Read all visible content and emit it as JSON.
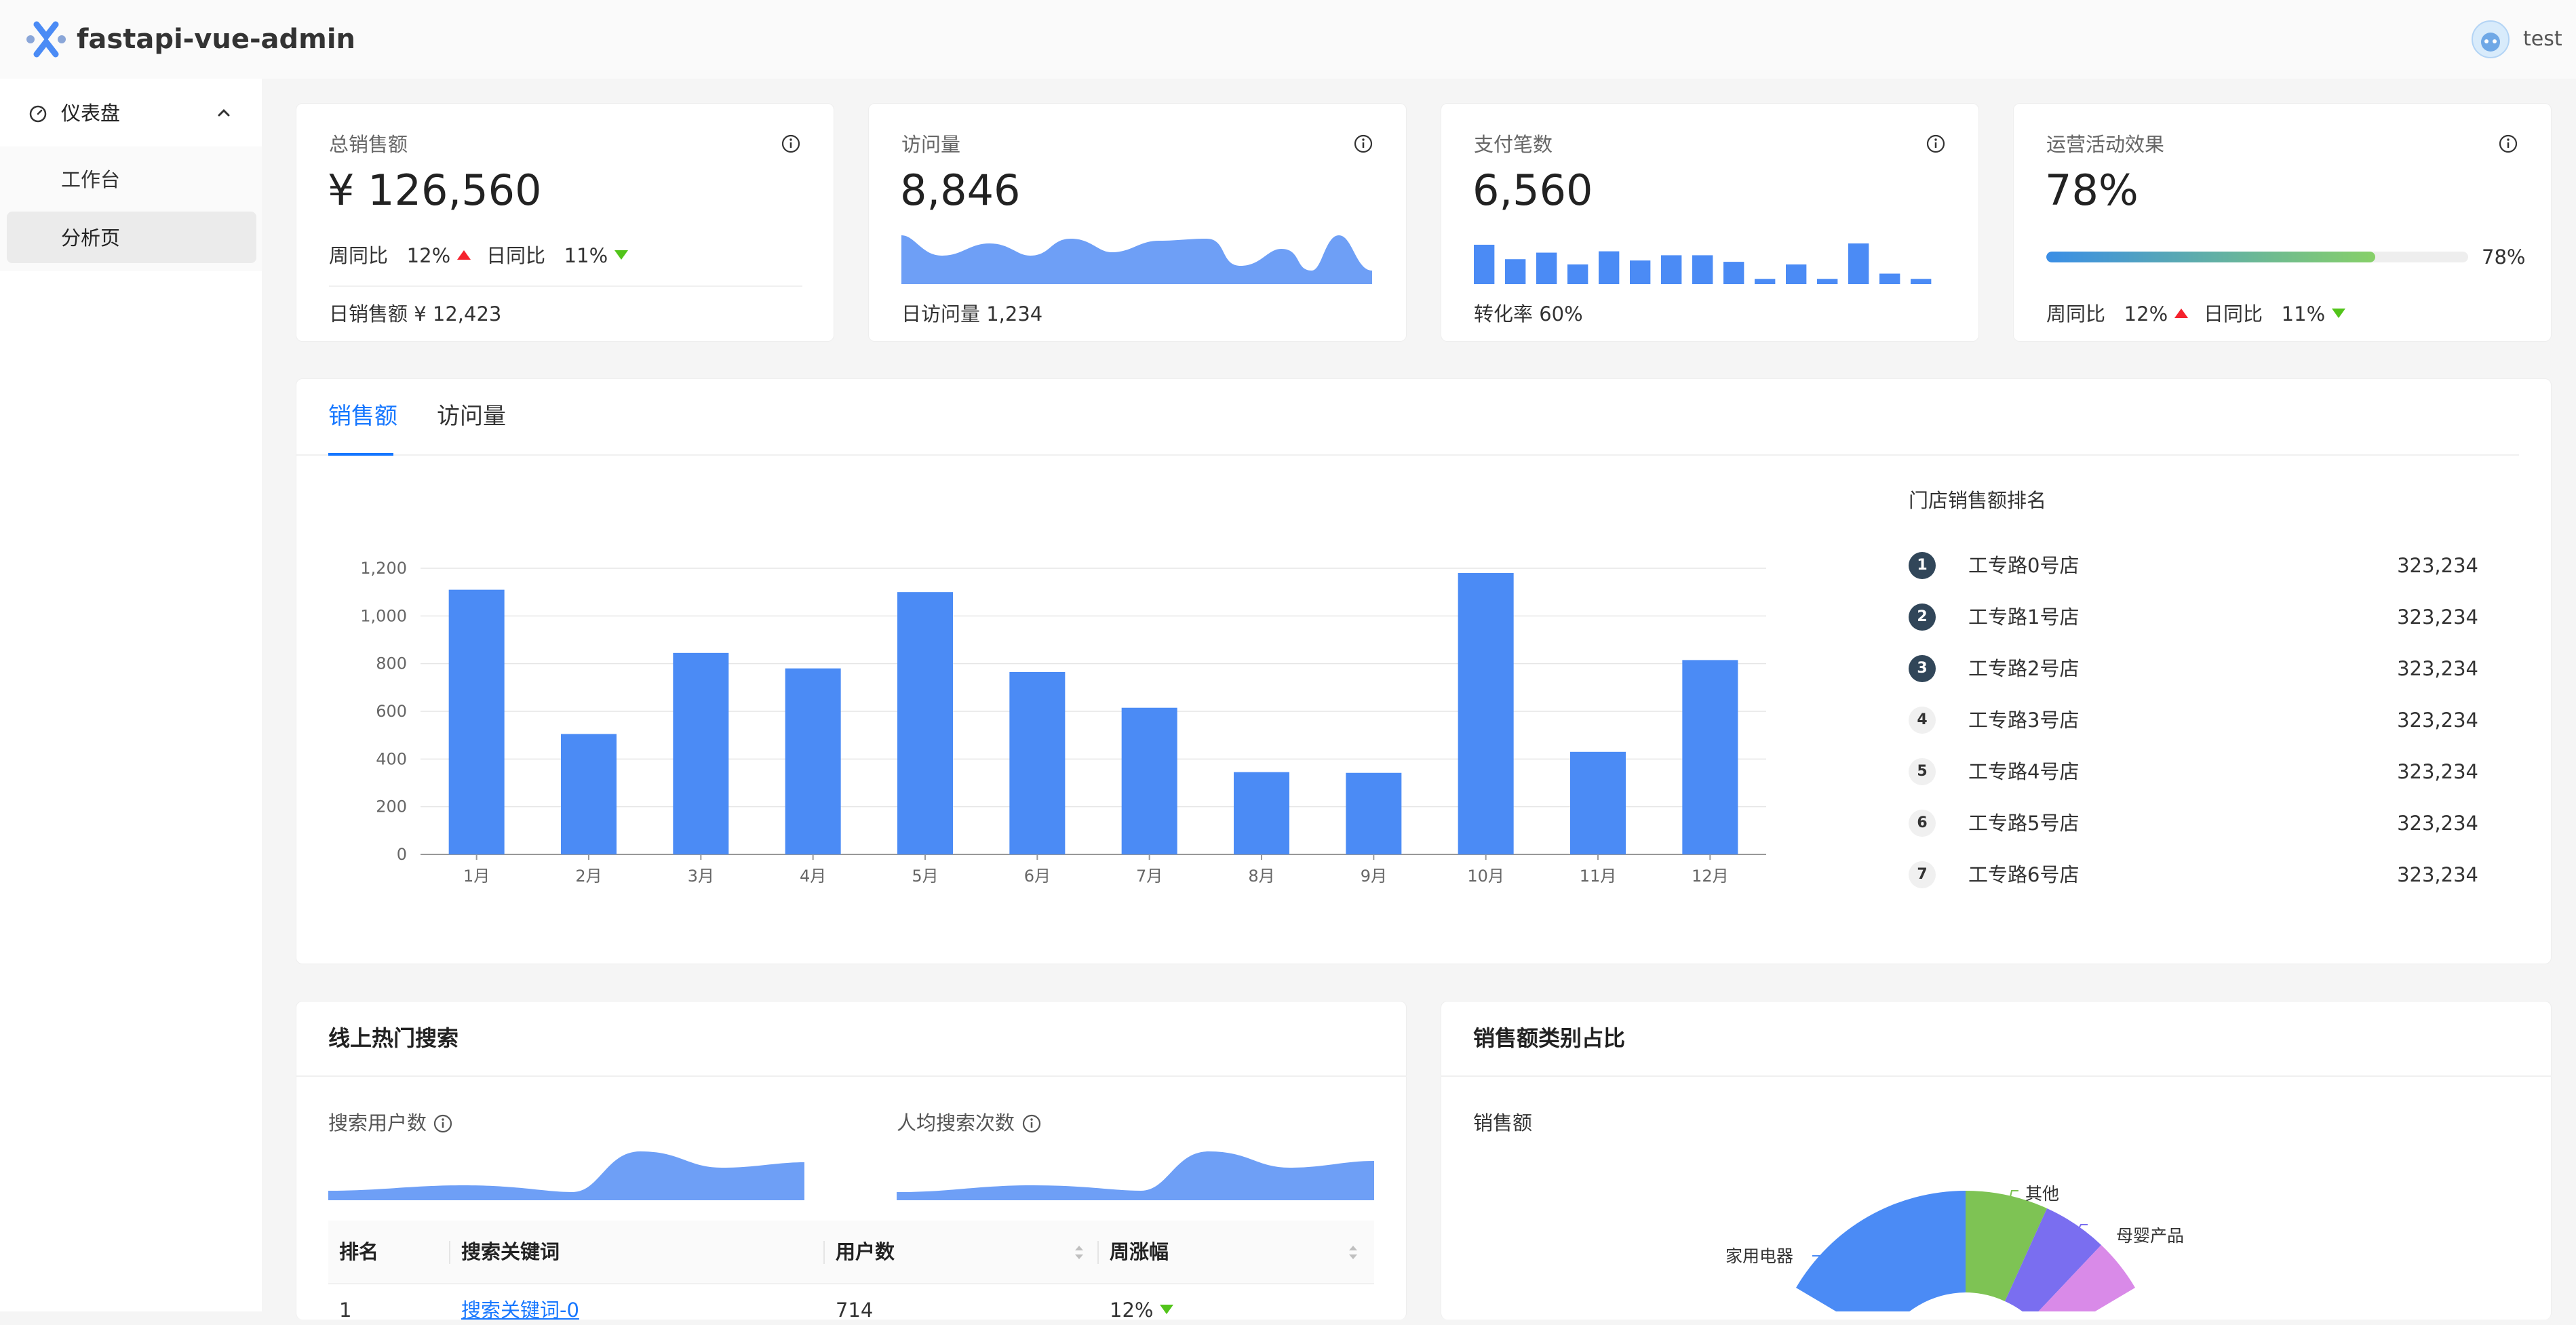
{
  "header": {
    "app_title": "fastapi-vue-admin",
    "username": "test"
  },
  "sidebar": {
    "group_label": "仪表盘",
    "items": [
      {
        "label": "工作台"
      },
      {
        "label": "分析页"
      }
    ]
  },
  "stats": [
    {
      "title": "总销售额",
      "value": "¥ 126,560",
      "compare": [
        {
          "label": "周同比",
          "value": "12%",
          "trend": "up"
        },
        {
          "label": "日同比",
          "value": "11%",
          "trend": "down"
        }
      ],
      "footer": "日销售额 ¥ 12,423"
    },
    {
      "title": "访问量",
      "value": "8,846",
      "footer": "日访问量 1,234"
    },
    {
      "title": "支付笔数",
      "value": "6,560",
      "footer": "转化率 60%"
    },
    {
      "title": "运营活动效果",
      "value": "78%",
      "progress_percent": 78,
      "progress_label": "78%",
      "compare": [
        {
          "label": "周同比",
          "value": "12%",
          "trend": "up"
        },
        {
          "label": "日同比",
          "value": "11%",
          "trend": "down"
        }
      ]
    }
  ],
  "sales_panel": {
    "tabs": [
      {
        "label": "销售额"
      },
      {
        "label": "访问量"
      }
    ],
    "ranking_title": "门店销售额排名",
    "ranking": [
      {
        "rank": "1",
        "name": "工专路0号店",
        "value": "323,234"
      },
      {
        "rank": "2",
        "name": "工专路1号店",
        "value": "323,234"
      },
      {
        "rank": "3",
        "name": "工专路2号店",
        "value": "323,234"
      },
      {
        "rank": "4",
        "name": "工专路3号店",
        "value": "323,234"
      },
      {
        "rank": "5",
        "name": "工专路4号店",
        "value": "323,234"
      },
      {
        "rank": "6",
        "name": "工专路5号店",
        "value": "323,234"
      },
      {
        "rank": "7",
        "name": "工专路6号店",
        "value": "323,234"
      }
    ]
  },
  "hot_search": {
    "title": "线上热门搜索",
    "metric_labels": [
      "搜索用户数",
      "人均搜索次数"
    ],
    "columns": [
      "排名",
      "搜索关键词",
      "用户数",
      "周涨幅"
    ],
    "rows": [
      {
        "rank": "1",
        "keyword": "搜索关键词-0",
        "users": "714",
        "change": "12%",
        "trend": "down"
      }
    ]
  },
  "category": {
    "title": "销售额类别占比",
    "sub_label": "销售额",
    "pie_labels": [
      "其他",
      "母婴产品",
      "家用电器"
    ]
  },
  "colors": {
    "primary": "#1677ff",
    "bar": "#4b8bf5",
    "area": "#6e9ff6",
    "up": "#f5222d",
    "down": "#52c41a"
  },
  "chart_data": {
    "type": "bar",
    "categories": [
      "1月",
      "2月",
      "3月",
      "4月",
      "5月",
      "6月",
      "7月",
      "8月",
      "9月",
      "10月",
      "11月",
      "12月"
    ],
    "values": [
      1110,
      505,
      845,
      780,
      1100,
      765,
      615,
      345,
      342,
      1180,
      430,
      815
    ],
    "yticks": [
      "0",
      "200",
      "400",
      "600",
      "800",
      "1,000",
      "1,200"
    ],
    "ylim": [
      0,
      1200
    ],
    "grid": true
  },
  "mini_charts": {
    "pay_bars": [
      0.6,
      0.38,
      0.48,
      0.3,
      0.5,
      0.36,
      0.44,
      0.44,
      0.34,
      0.08,
      0.3,
      0.08,
      0.62,
      0.16,
      0.08
    ]
  }
}
